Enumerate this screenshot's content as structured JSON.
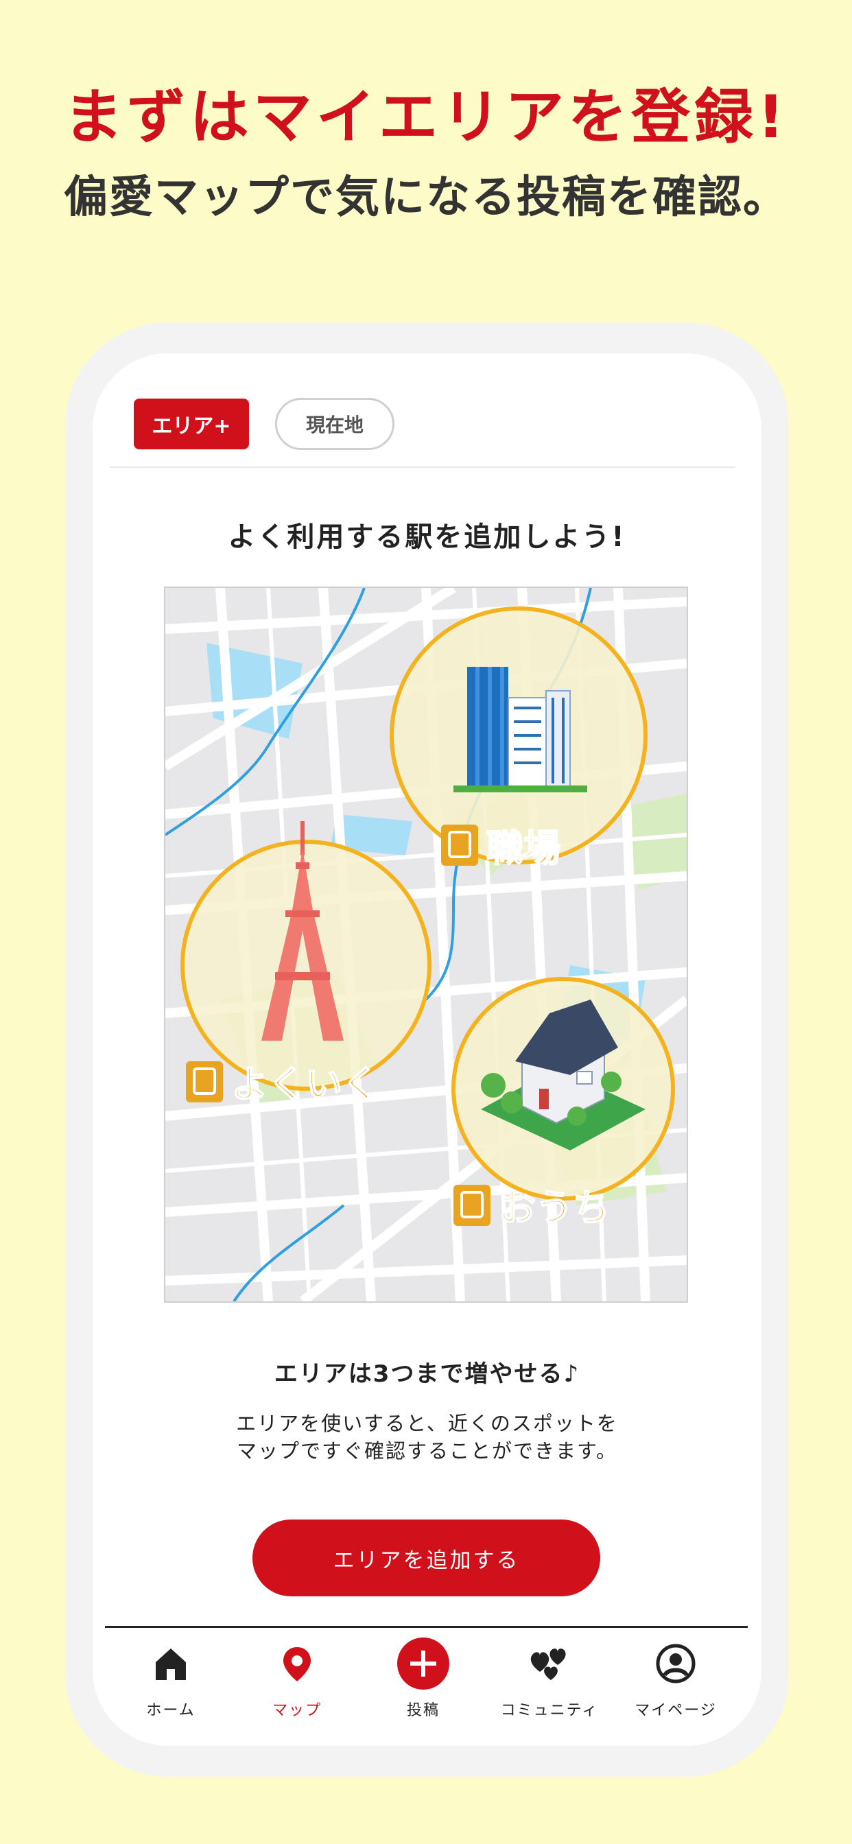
{
  "promo": {
    "headline": "まずはマイエリアを登録!",
    "subline": "偏愛マップで気になる投稿を確認。"
  },
  "tabs": {
    "area_add": "エリア+",
    "current_location": "現在地"
  },
  "screen": {
    "title": "よく利用する駅を追加しよう!"
  },
  "map": {
    "labels": {
      "work": "職場",
      "often": "よくいく",
      "home": "おうち"
    }
  },
  "info": {
    "title": "エリアは3つまで増やせる♪",
    "body_line1": "エリアを使いすると、近くのスポットを",
    "body_line2": "マップですぐ確認することができます。"
  },
  "buttons": {
    "add_area": "エリアを追加する"
  },
  "nav": {
    "items": [
      {
        "label": "ホーム",
        "icon": "home-icon"
      },
      {
        "label": "マップ",
        "icon": "map-pin-icon",
        "active": true
      },
      {
        "label": "投稿",
        "icon": "plus-circle-icon"
      },
      {
        "label": "コミュニティ",
        "icon": "hearts-icon"
      },
      {
        "label": "マイページ",
        "icon": "user-circle-icon"
      }
    ]
  },
  "colors": {
    "brand_red": "#d0101a",
    "background": "#fdfbc8",
    "circle_orange": "#f5b21f"
  }
}
